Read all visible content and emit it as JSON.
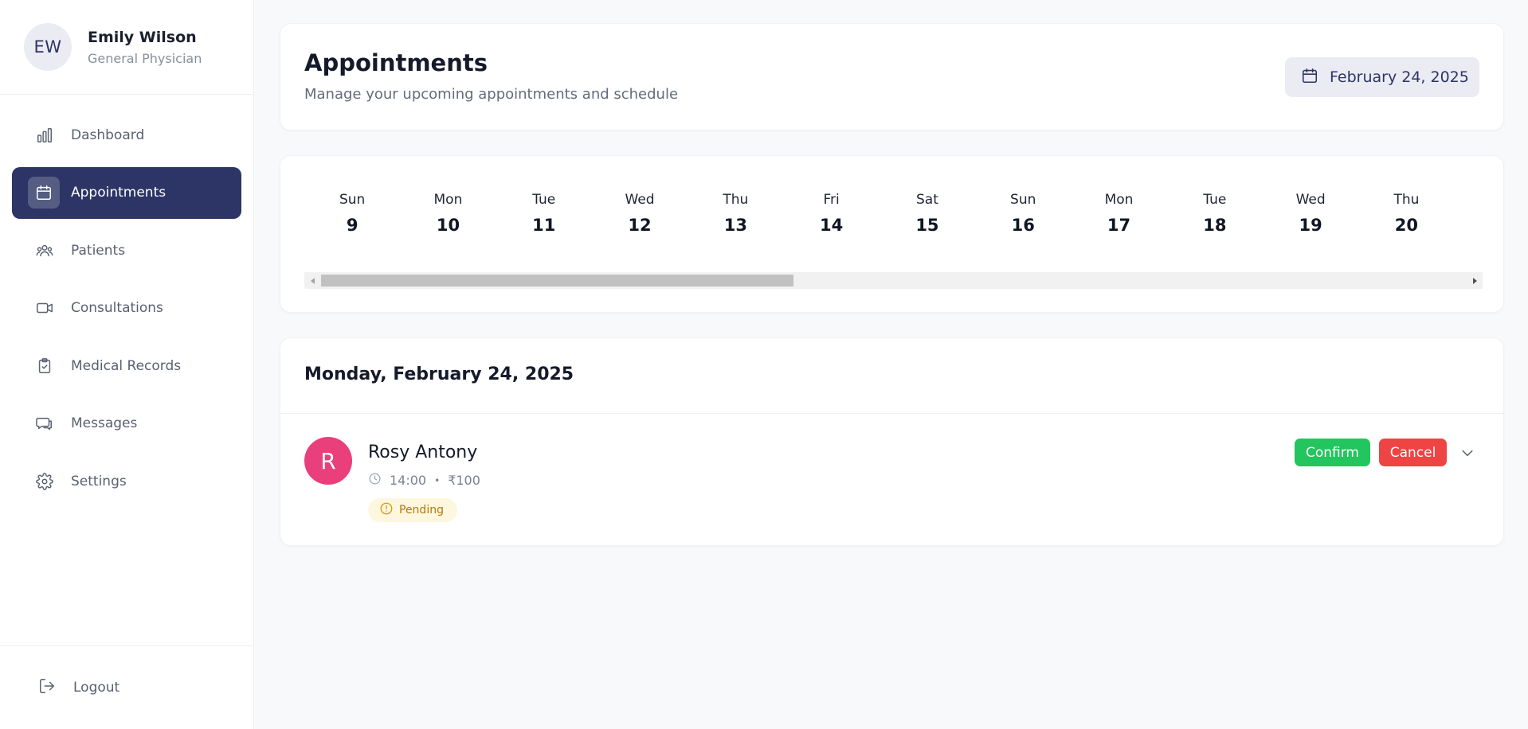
{
  "user": {
    "initials": "EW",
    "name": "Emily Wilson",
    "role": "General Physician"
  },
  "sidebar": {
    "items": [
      {
        "label": "Dashboard",
        "icon": "bar-chart-icon",
        "active": false
      },
      {
        "label": "Appointments",
        "icon": "calendar-icon",
        "active": true
      },
      {
        "label": "Patients",
        "icon": "users-icon",
        "active": false
      },
      {
        "label": "Consultations",
        "icon": "video-icon",
        "active": false
      },
      {
        "label": "Medical Records",
        "icon": "clipboard-icon",
        "active": false
      },
      {
        "label": "Messages",
        "icon": "chat-icon",
        "active": false
      },
      {
        "label": "Settings",
        "icon": "gear-icon",
        "active": false
      }
    ],
    "logout_label": "Logout"
  },
  "header": {
    "title": "Appointments",
    "subtitle": "Manage your upcoming appointments and schedule",
    "date_label": "February 24, 2025"
  },
  "days": [
    {
      "name": "Sun",
      "num": "9"
    },
    {
      "name": "Mon",
      "num": "10"
    },
    {
      "name": "Tue",
      "num": "11"
    },
    {
      "name": "Wed",
      "num": "12"
    },
    {
      "name": "Thu",
      "num": "13"
    },
    {
      "name": "Fri",
      "num": "14"
    },
    {
      "name": "Sat",
      "num": "15"
    },
    {
      "name": "Sun",
      "num": "16"
    },
    {
      "name": "Mon",
      "num": "17"
    },
    {
      "name": "Tue",
      "num": "18"
    },
    {
      "name": "Wed",
      "num": "19"
    },
    {
      "name": "Thu",
      "num": "20"
    }
  ],
  "schedule": {
    "date_heading": "Monday, February 24, 2025",
    "appointments": [
      {
        "avatar_letter": "R",
        "patient": "Rosy Antony",
        "time": "14:00",
        "separator": "•",
        "fee": "₹100",
        "status": "Pending",
        "confirm_label": "Confirm",
        "cancel_label": "Cancel"
      }
    ]
  },
  "colors": {
    "primary": "#2c3565",
    "confirm": "#22c55e",
    "cancel": "#ef4444",
    "avatar_pink": "#e93f7b",
    "pending_text": "#b17a06",
    "pending_bg": "#fef7df"
  }
}
